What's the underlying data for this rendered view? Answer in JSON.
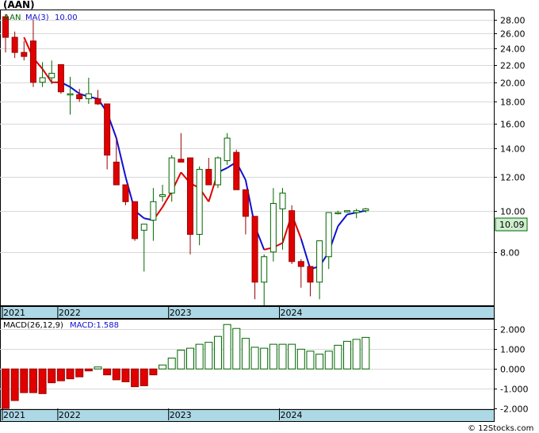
{
  "ticker_title": "(AAN)",
  "legend": {
    "symbol": "AAN",
    "ma_label": "MA(3)",
    "ma_value": "10.00"
  },
  "macd_legend": {
    "label": "MACD(26,12,9)",
    "value_label": "MACD:1.588"
  },
  "last_price_box": "10.09",
  "watermark": "© 12Stocks.com",
  "colors": {
    "up": "#ffffff",
    "down": "#e00000",
    "up_stroke": "#006600",
    "down_stroke": "#990000",
    "ma_down": "#e00000",
    "ma_up": "#1010d0",
    "macd_neg": "#e00000",
    "macd_pos": "#006600",
    "axis_band": "#add8e6"
  },
  "chart_data": [
    {
      "type": "candlestick",
      "title": "(AAN)",
      "scale": "log",
      "ylim": [
        6.0,
        29.5
      ],
      "y_ticks": [
        28,
        26,
        24,
        22,
        20,
        18,
        16,
        14,
        12,
        10,
        8
      ],
      "y_tick_labels": [
        "28.00",
        "26.00",
        "24.00",
        "22.00",
        "20.00",
        "18.00",
        "16.00",
        "14.00",
        "12.00",
        "10.00",
        "8.00"
      ],
      "x_labels": [
        {
          "label": "2021",
          "month_index": 0
        },
        {
          "label": "2022",
          "month_index": 6
        },
        {
          "label": "2023",
          "month_index": 18
        },
        {
          "label": "2024",
          "month_index": 30
        }
      ],
      "candles": [
        {
          "o": 28.5,
          "h": 28.9,
          "l": 23.5,
          "c": 25.5
        },
        {
          "o": 25.5,
          "h": 26.3,
          "l": 22.8,
          "c": 23.5
        },
        {
          "o": 23.5,
          "h": 25.0,
          "l": 22.5,
          "c": 23.0
        },
        {
          "o": 25.0,
          "h": 28.0,
          "l": 19.5,
          "c": 20.0
        },
        {
          "o": 20.0,
          "h": 22.3,
          "l": 19.5,
          "c": 20.5
        },
        {
          "o": 20.5,
          "h": 22.5,
          "l": 19.8,
          "c": 21.0
        },
        {
          "o": 22.0,
          "h": 22.0,
          "l": 18.8,
          "c": 19.0
        },
        {
          "o": 18.8,
          "h": 20.6,
          "l": 16.8,
          "c": 18.8
        },
        {
          "o": 18.7,
          "h": 19.3,
          "l": 18.0,
          "c": 18.3
        },
        {
          "o": 18.3,
          "h": 20.5,
          "l": 17.8,
          "c": 18.8
        },
        {
          "o": 18.3,
          "h": 19.2,
          "l": 17.7,
          "c": 17.8
        },
        {
          "o": 17.8,
          "h": 17.8,
          "l": 12.5,
          "c": 13.5
        },
        {
          "o": 13.0,
          "h": 14.8,
          "l": 11.5,
          "c": 11.5
        },
        {
          "o": 11.5,
          "h": 11.5,
          "l": 10.3,
          "c": 10.5
        },
        {
          "o": 10.5,
          "h": 10.5,
          "l": 8.5,
          "c": 8.6
        },
        {
          "o": 9.0,
          "h": 9.3,
          "l": 7.2,
          "c": 9.3
        },
        {
          "o": 9.5,
          "h": 11.3,
          "l": 8.5,
          "c": 10.5
        },
        {
          "o": 10.8,
          "h": 11.5,
          "l": 10.5,
          "c": 10.9
        },
        {
          "o": 11.0,
          "h": 13.5,
          "l": 10.5,
          "c": 13.3
        },
        {
          "o": 13.2,
          "h": 15.2,
          "l": 13.0,
          "c": 13.0
        },
        {
          "o": 13.3,
          "h": 13.3,
          "l": 7.9,
          "c": 8.8
        },
        {
          "o": 8.8,
          "h": 12.7,
          "l": 8.3,
          "c": 12.5
        },
        {
          "o": 12.5,
          "h": 13.3,
          "l": 11.5,
          "c": 11.5
        },
        {
          "o": 11.5,
          "h": 13.4,
          "l": 11.3,
          "c": 13.3
        },
        {
          "o": 13.1,
          "h": 15.2,
          "l": 12.8,
          "c": 14.8
        },
        {
          "o": 13.7,
          "h": 13.9,
          "l": 11.2,
          "c": 11.2
        },
        {
          "o": 11.2,
          "h": 11.2,
          "l": 8.8,
          "c": 9.7
        },
        {
          "o": 9.7,
          "h": 9.7,
          "l": 6.2,
          "c": 6.8
        },
        {
          "o": 6.8,
          "h": 7.9,
          "l": 6.0,
          "c": 7.8
        },
        {
          "o": 8.0,
          "h": 11.3,
          "l": 7.6,
          "c": 10.4
        },
        {
          "o": 10.1,
          "h": 11.3,
          "l": 8.1,
          "c": 11.0
        },
        {
          "o": 10.0,
          "h": 10.3,
          "l": 7.5,
          "c": 7.6
        },
        {
          "o": 7.6,
          "h": 7.7,
          "l": 6.6,
          "c": 7.4
        },
        {
          "o": 7.4,
          "h": 7.4,
          "l": 6.3,
          "c": 6.8
        },
        {
          "o": 6.8,
          "h": 8.5,
          "l": 6.2,
          "c": 8.5
        },
        {
          "o": 7.8,
          "h": 9.9,
          "l": 7.3,
          "c": 9.9
        },
        {
          "o": 9.9,
          "h": 10.0,
          "l": 9.8,
          "c": 9.9
        },
        {
          "o": 10.0,
          "h": 10.0,
          "l": 9.9,
          "c": 10.0
        },
        {
          "o": 9.9,
          "h": 10.1,
          "l": 9.6,
          "c": 10.0
        },
        {
          "o": 10.0,
          "h": 10.15,
          "l": 9.9,
          "c": 10.1
        }
      ],
      "ma3": [
        null,
        null,
        25.5,
        22.8,
        21.5,
        20.0,
        20.0,
        19.5,
        18.8,
        18.5,
        18.3,
        17.0,
        14.8,
        12.0,
        10.0,
        9.6,
        9.5,
        10.2,
        11.1,
        12.3,
        11.6,
        11.3,
        10.5,
        12.3,
        12.6,
        13.0,
        11.8,
        9.2,
        8.1,
        8.2,
        8.4,
        9.8,
        8.6,
        7.3,
        7.4,
        8.0,
        9.2,
        9.8,
        9.9,
        10.0
      ],
      "ma_color_switch_index": [
        7,
        17,
        24,
        29,
        33
      ]
    },
    {
      "type": "bar",
      "title": "MACD(26,12,9)",
      "ylim": [
        -2.0,
        2.5
      ],
      "y_ticks": [
        2,
        1,
        0,
        -1,
        -2
      ],
      "y_tick_labels": [
        "2.000",
        "1.000",
        "0.000",
        "-1.000",
        "-2.000"
      ],
      "values": [
        -2.0,
        -1.6,
        -1.2,
        -1.2,
        -1.25,
        -0.7,
        -0.6,
        -0.5,
        -0.4,
        -0.1,
        0.1,
        -0.3,
        -0.55,
        -0.65,
        -0.9,
        -0.85,
        -0.3,
        0.2,
        0.55,
        0.95,
        1.05,
        1.25,
        1.35,
        1.65,
        2.25,
        2.05,
        1.55,
        1.1,
        1.05,
        1.25,
        1.25,
        1.25,
        1.0,
        0.9,
        0.75,
        0.9,
        1.2,
        1.4,
        1.5,
        1.6
      ]
    }
  ]
}
